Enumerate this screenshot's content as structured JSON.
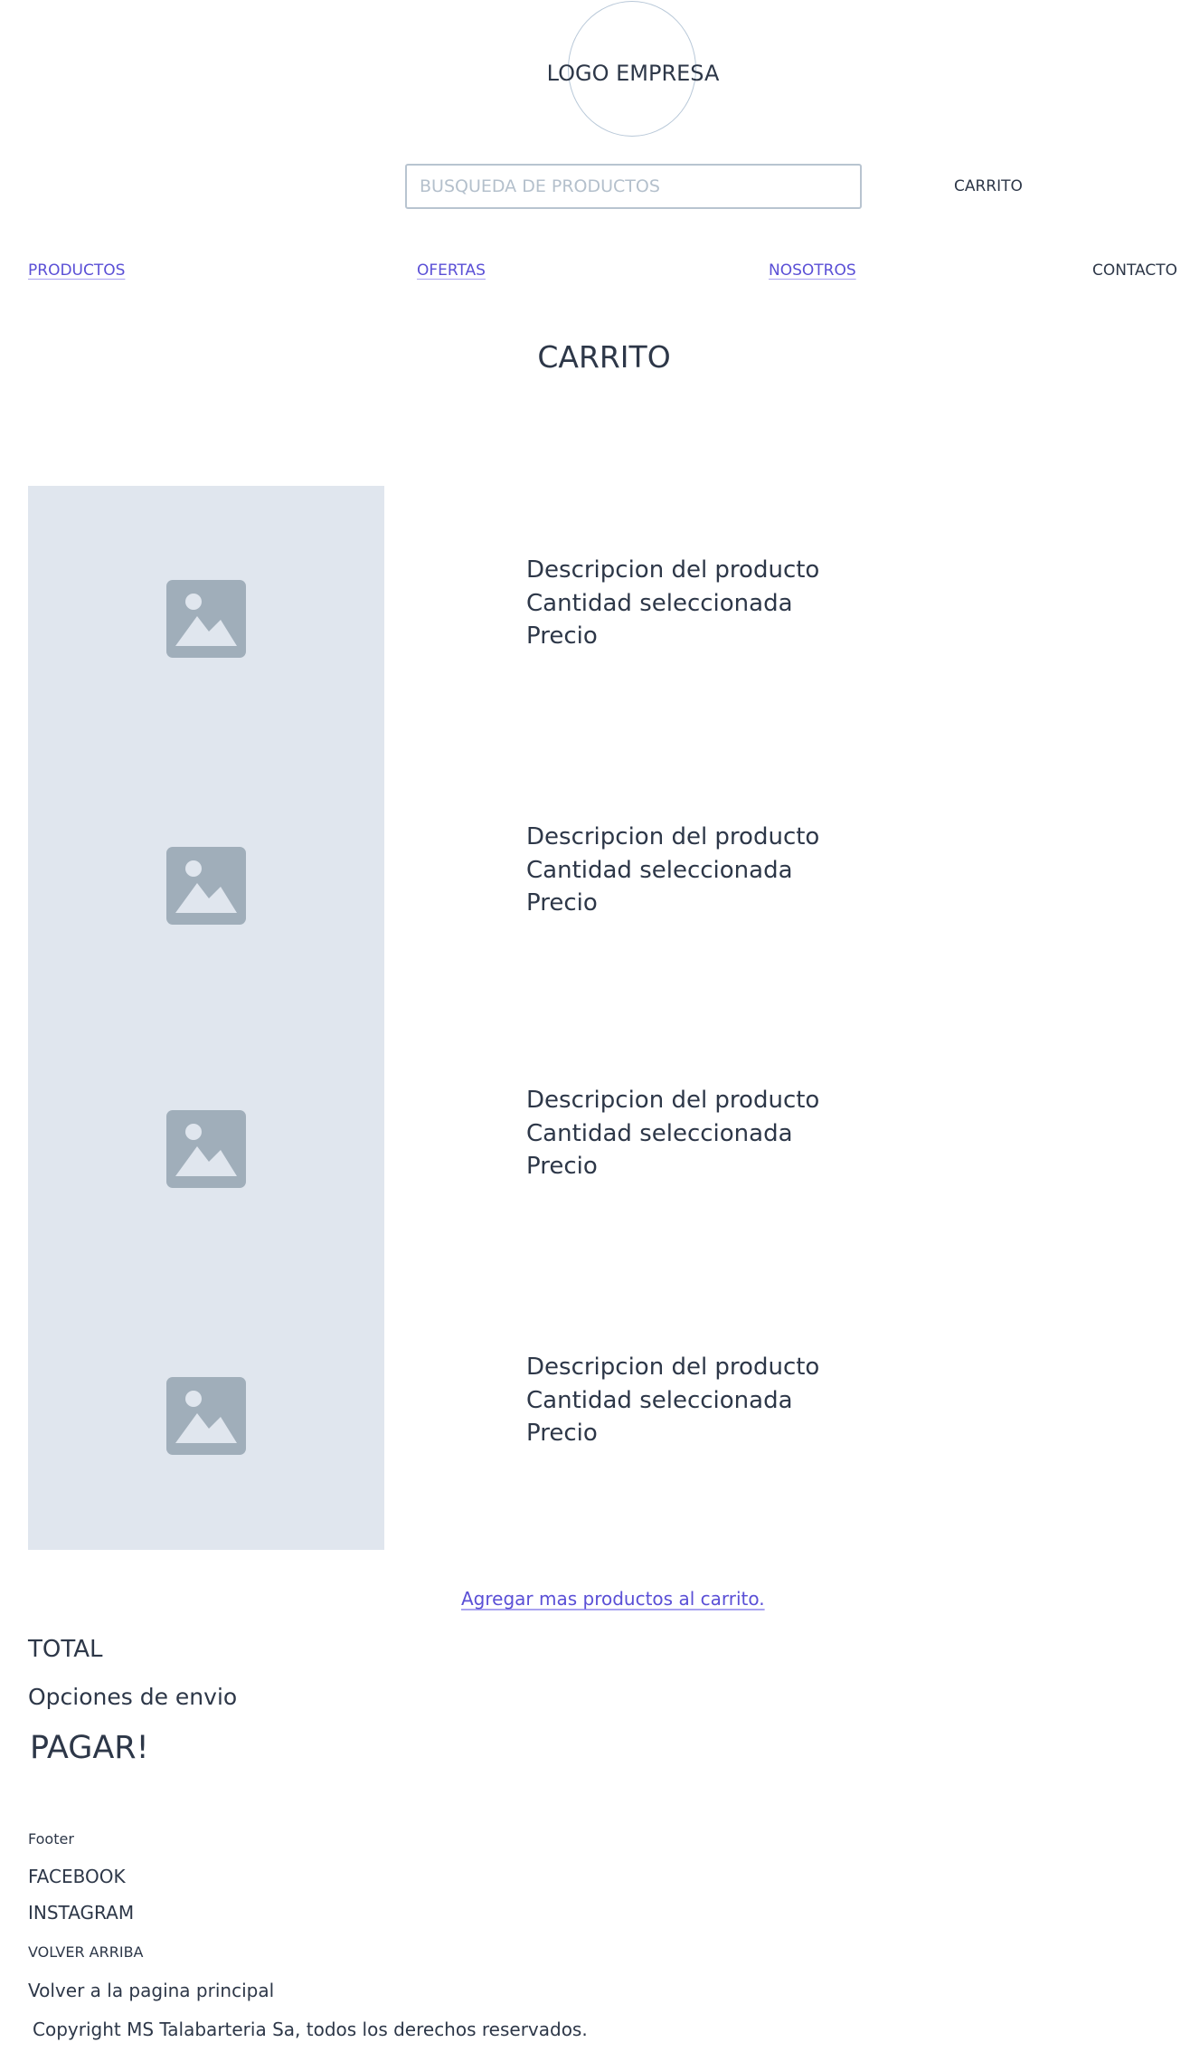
{
  "header": {
    "logo_text": "LOGO EMPRESA",
    "search_placeholder": "BUSQUEDA DE PRODUCTOS",
    "search_value": "",
    "cart_label": "CARRITO"
  },
  "nav": {
    "items": [
      {
        "label": "PRODUCTOS"
      },
      {
        "label": "OFERTAS"
      },
      {
        "label": "NOSOTROS"
      },
      {
        "label": "CONTACTO"
      }
    ]
  },
  "page": {
    "title": "CARRITO"
  },
  "cart": {
    "items": [
      {
        "description": "Descripcion del producto",
        "quantity": "Cantidad seleccionada",
        "price": "Precio",
        "image_icon": "image-placeholder-icon"
      },
      {
        "description": "Descripcion del producto",
        "quantity": "Cantidad seleccionada",
        "price": "Precio",
        "image_icon": "image-placeholder-icon"
      },
      {
        "description": "Descripcion del producto",
        "quantity": "Cantidad seleccionada",
        "price": "Precio",
        "image_icon": "image-placeholder-icon"
      },
      {
        "description": "Descripcion del producto",
        "quantity": "Cantidad seleccionada",
        "price": "Precio",
        "image_icon": "image-placeholder-icon"
      }
    ],
    "add_more_link": "Agregar mas productos al carrito.",
    "total_label": "TOTAL",
    "shipping_label": "Opciones de envio",
    "pay_label": "PAGAR!"
  },
  "footer": {
    "title": "Footer",
    "facebook": "FACEBOOK",
    "instagram": "INSTAGRAM",
    "back_to_top": "VOLVER ARRIBA",
    "main_page": "Volver a la pagina principal",
    "copyright": "Copyright MS Talabarteria Sa, todos los derechos reservados."
  },
  "colors": {
    "text": "#2d3748",
    "link": "#5a4fd6",
    "link_underline": "#a9a3f0",
    "image_bg": "#e0e6ee",
    "icon": "#a0aeba",
    "border": "#b8c4d0"
  }
}
